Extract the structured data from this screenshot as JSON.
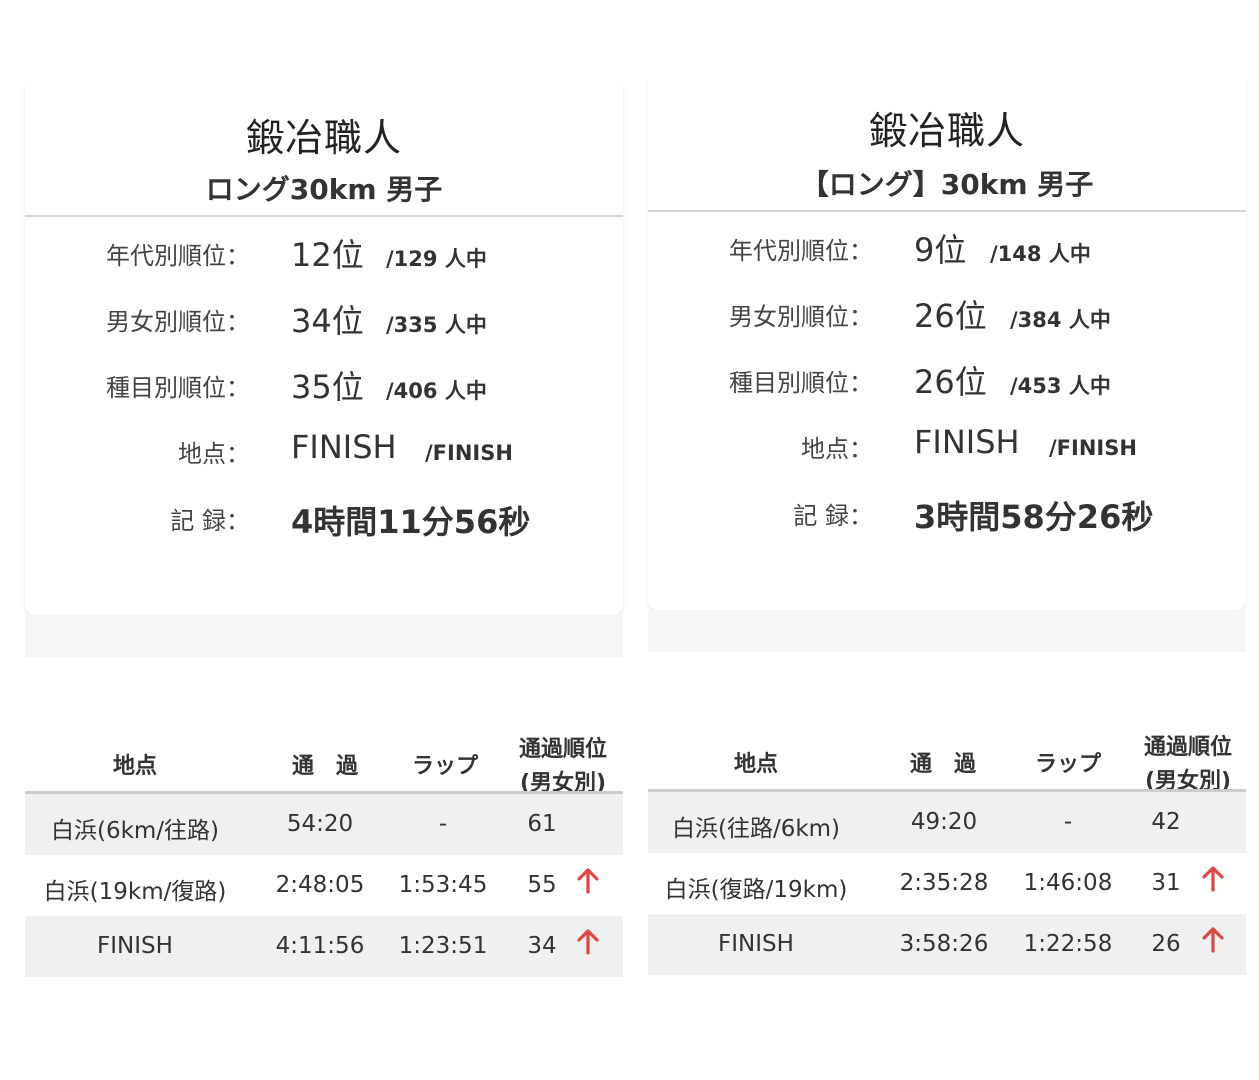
{
  "left": {
    "name": "鍛冶職人",
    "category": "ロング30km 男子",
    "stats": [
      {
        "label": "年代別順位：",
        "value": "12位",
        "sub": "/129 人中"
      },
      {
        "label": "男女別順位：",
        "value": "34位",
        "sub": "/335 人中"
      },
      {
        "label": "種目別順位：",
        "value": "35位",
        "sub": "/406 人中"
      },
      {
        "label": "地点：",
        "value": "FINISH",
        "sub": "/FINISH"
      }
    ],
    "record": {
      "label": "記 録：",
      "value": "4時間11分56秒"
    },
    "split_headers": {
      "point": "地点",
      "pass": "通　過",
      "lap": "ラップ",
      "rank_line1": "通過順位",
      "rank_line2": "(男女別)"
    },
    "splits": [
      {
        "point": "白浜(6km/往路)",
        "pass": "54:20",
        "lap": "-",
        "rank": "61",
        "trend": "none"
      },
      {
        "point": "白浜(19km/復路)",
        "pass": "2:48:05",
        "lap": "1:53:45",
        "rank": "55",
        "trend": "up"
      },
      {
        "point": "FINISH",
        "pass": "4:11:56",
        "lap": "1:23:51",
        "rank": "34",
        "trend": "up"
      }
    ]
  },
  "right": {
    "name": "鍛冶職人",
    "category": "【ロング】30km 男子",
    "stats": [
      {
        "label": "年代別順位：",
        "value": "9位",
        "sub": "/148 人中"
      },
      {
        "label": "男女別順位：",
        "value": "26位",
        "sub": "/384 人中"
      },
      {
        "label": "種目別順位：",
        "value": "26位",
        "sub": "/453 人中"
      },
      {
        "label": "地点：",
        "value": "FINISH",
        "sub": "/FINISH"
      }
    ],
    "record": {
      "label": "記 録：",
      "value": "3時間58分26秒"
    },
    "split_headers": {
      "point": "地点",
      "pass": "通　過",
      "lap": "ラップ",
      "rank_line1": "通過順位",
      "rank_line2": "(男女別)"
    },
    "splits": [
      {
        "point": "白浜(往路/6km)",
        "pass": "49:20",
        "lap": "-",
        "rank": "42",
        "trend": "none"
      },
      {
        "point": "白浜(復路/19km)",
        "pass": "2:35:28",
        "lap": "1:46:08",
        "rank": "31",
        "trend": "up"
      },
      {
        "point": "FINISH",
        "pass": "3:58:26",
        "lap": "1:22:58",
        "rank": "26",
        "trend": "up"
      }
    ]
  },
  "colors": {
    "arrow_up": "#e0453f",
    "row_shade": "#f0f0f0",
    "divider": "#d6d6d6"
  },
  "icons": {
    "trend_up": "arrow-up-icon"
  }
}
